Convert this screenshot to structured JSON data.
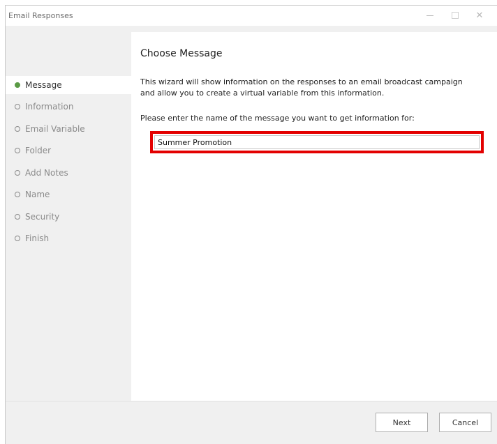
{
  "window": {
    "title": "Email Responses",
    "controls": {
      "minimize_icon": "minimize-icon",
      "maximize_icon": "maximize-icon",
      "close_icon": "close-icon",
      "close_glyph": "✕"
    }
  },
  "steps": [
    {
      "label": "Message",
      "active": true
    },
    {
      "label": "Information",
      "active": false
    },
    {
      "label": "Email Variable",
      "active": false
    },
    {
      "label": "Folder",
      "active": false
    },
    {
      "label": "Add Notes",
      "active": false
    },
    {
      "label": "Name",
      "active": false
    },
    {
      "label": "Security",
      "active": false
    },
    {
      "label": "Finish",
      "active": false
    }
  ],
  "main": {
    "title": "Choose Message",
    "description_line1": "This wizard will show information on the responses to an email broadcast campaign",
    "description_line2": "and allow you to create a virtual variable from this information.",
    "prompt": "Please enter the name of the message you want to get information for:",
    "message_value": "Summer Promotion"
  },
  "buttons": {
    "next": "Next",
    "cancel": "Cancel"
  },
  "colors": {
    "active_step": "#5a9a45",
    "highlight_border": "#e30000"
  }
}
